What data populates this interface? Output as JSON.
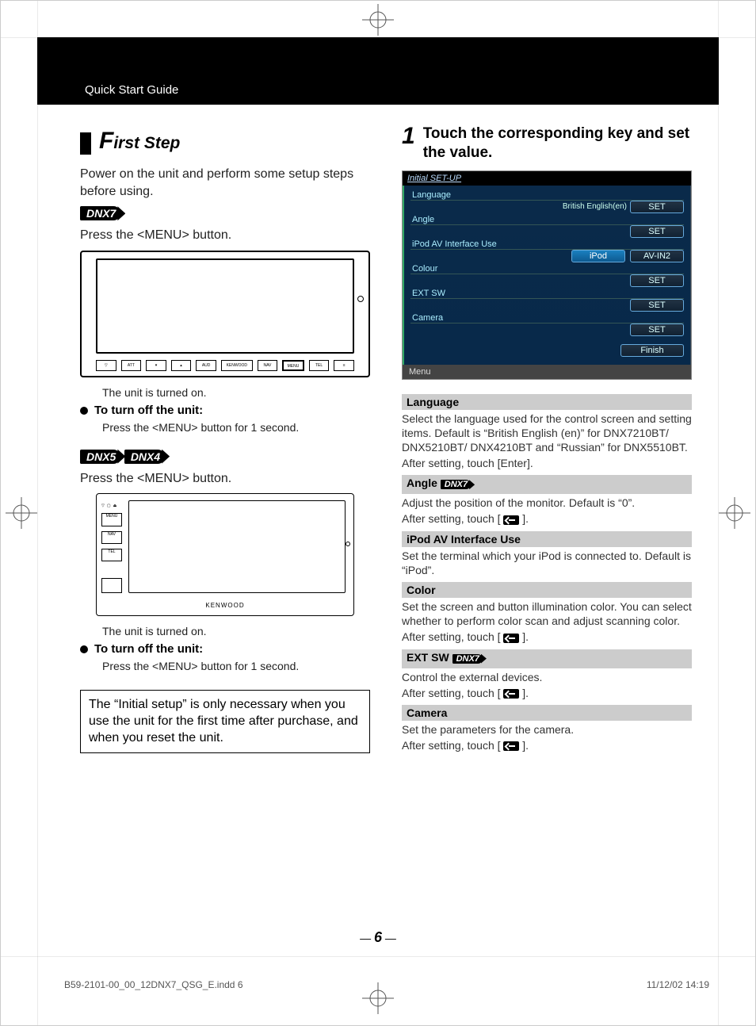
{
  "header_label": "Quick Start Guide",
  "left": {
    "h1_big": "F",
    "h1_rest": "irst Step",
    "intro": "Power on the unit and perform some setup steps before using.",
    "chip_dnx7": "DNX7",
    "press_menu": "Press the <MENU> button.",
    "turned_on": "The unit is turned on.",
    "turn_off_label": "To turn off the unit:",
    "turn_off_detail": "Press the <MENU> button for 1 second.",
    "chip_dnx5": "DNX5",
    "chip_dnx4": "DNX4",
    "note": "The “Initial setup” is only necessary when you use the unit for the first time after purchase, and when you reset the unit."
  },
  "right": {
    "step_num": "1",
    "step_txt": "Touch the corresponding key and set the value.",
    "ui": {
      "title": "Initial SET-UP",
      "rows": [
        {
          "label": "Language",
          "value": "British English(en)",
          "buttons": [
            "SET"
          ]
        },
        {
          "label": "Angle",
          "value": "",
          "buttons": [
            "SET"
          ]
        },
        {
          "label": "iPod AV Interface Use",
          "value": "",
          "buttons_sel": "iPod",
          "buttons": [
            "AV-IN2"
          ]
        },
        {
          "label": "Colour",
          "value": "",
          "buttons": [
            "SET"
          ]
        },
        {
          "label": "EXT SW",
          "value": "",
          "buttons": [
            "SET"
          ]
        },
        {
          "label": "Camera",
          "value": "",
          "buttons": [
            "SET"
          ]
        }
      ],
      "finish": "Finish",
      "footer": "Menu"
    },
    "defs": {
      "language_h": "Language",
      "language_t1": "Select the language used for the control screen and setting items. Default is “British English (en)” for DNX7210BT/ DNX5210BT/ DNX4210BT and “Russian” for DNX5510BT.",
      "language_t2": "After setting, touch [Enter].",
      "angle_h": "Angle",
      "angle_t1": "Adjust the position of the monitor. Default is “0”.",
      "after_return": "After setting, touch [",
      "after_return_close": "].",
      "ipod_h": "iPod AV Interface Use",
      "ipod_t1": "Set the terminal which your iPod is connected to. Default is “iPod”.",
      "color_h": "Color",
      "color_t1": "Set the screen and button illumination color. You can select whether to perform color scan and adjust scanning color.",
      "extsw_h": "EXT SW",
      "extsw_t1": "Control the external devices.",
      "camera_h": "Camera",
      "camera_t1": "Set the parameters for the camera."
    }
  },
  "page_num": "6",
  "imprint_left": "B59-2101-00_00_12DNX7_QSG_E.indd   6",
  "imprint_right": "11/12/02   14:19"
}
